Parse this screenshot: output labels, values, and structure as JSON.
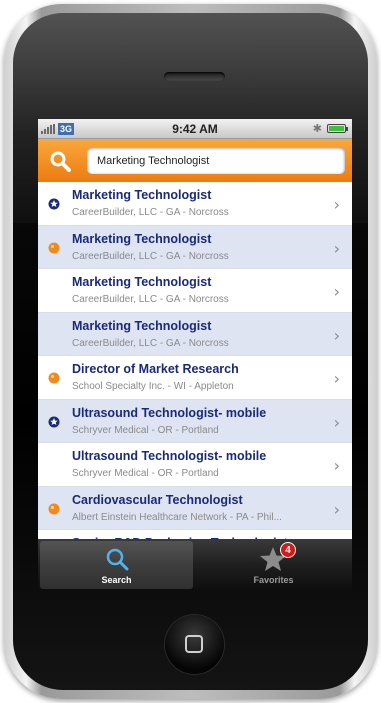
{
  "status_bar": {
    "carrier": "3G",
    "time": "9:42 AM"
  },
  "search": {
    "query": "Marketing Technologist",
    "placeholder": ""
  },
  "jobs": [
    {
      "title": "Marketing Technologist",
      "company": "CareerBuilder, LLC - GA - Norcross",
      "icon": "star-badge-icon",
      "highlighted": false
    },
    {
      "title": "Marketing Technologist",
      "company": "CareerBuilder, LLC - GA - Norcross",
      "icon": "orange-dot-icon",
      "highlighted": true
    },
    {
      "title": "Marketing Technologist",
      "company": "CareerBuilder, LLC - GA - Norcross",
      "icon": "",
      "highlighted": false
    },
    {
      "title": "Marketing Technologist",
      "company": "CareerBuilder, LLC - GA - Norcross",
      "icon": "",
      "highlighted": true
    },
    {
      "title": "Director of Market Research",
      "company": "School Specialty Inc. - WI - Appleton",
      "icon": "orange-dot-icon",
      "highlighted": false
    },
    {
      "title": "Ultrasound Technologist- mobile",
      "company": "Schryver Medical - OR - Portland",
      "icon": "star-badge-icon",
      "highlighted": true
    },
    {
      "title": "Ultrasound Technologist- mobile",
      "company": "Schryver Medical - OR - Portland",
      "icon": "",
      "highlighted": false
    },
    {
      "title": "Cardiovascular Technologist",
      "company": "Albert Einstein Healthcare Network - PA - Phil...",
      "icon": "orange-dot-icon",
      "highlighted": true
    },
    {
      "title": "Senior R&D Packaging Technologist",
      "company": "",
      "icon": "",
      "highlighted": false
    }
  ],
  "tabs": [
    {
      "label": "Search",
      "icon": "magnifier-icon",
      "active": true
    },
    {
      "label": "Favorites",
      "icon": "star-icon",
      "active": false,
      "badge": "4"
    }
  ],
  "colors": {
    "accent_orange": "#F08A1C",
    "title_blue": "#1a2a7a",
    "row_alt": "#dfe4f3"
  }
}
